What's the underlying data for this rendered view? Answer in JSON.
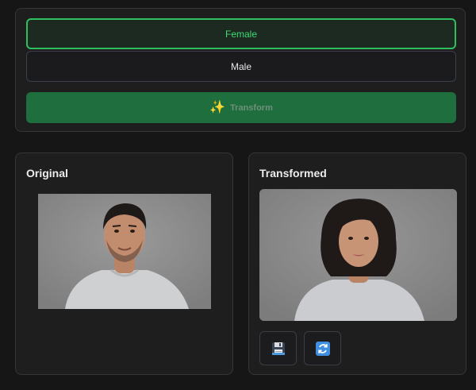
{
  "options": {
    "female_label": "Female",
    "male_label": "Male",
    "selected": "Female"
  },
  "transform_button": {
    "label": "Transform",
    "icon": "sparkles-icon"
  },
  "original": {
    "title": "Original",
    "image": "man-portrait"
  },
  "transformed": {
    "title": "Transformed",
    "image": "woman-portrait",
    "actions": [
      {
        "name": "save",
        "icon": "floppy-disk-icon"
      },
      {
        "name": "reset",
        "icon": "refresh-icon"
      }
    ]
  },
  "colors": {
    "accent": "#2fbf5f",
    "transform_bg": "#1f6f3e",
    "panel_bg": "#1e1e1f",
    "page_bg": "#161616"
  }
}
